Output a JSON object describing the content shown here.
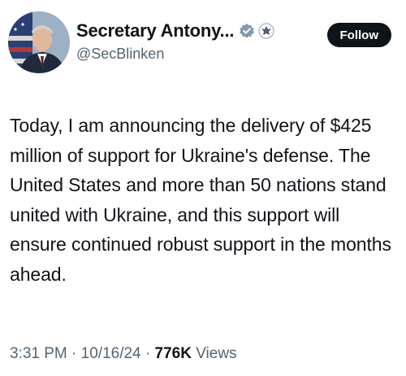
{
  "author": {
    "display_name": "Secretary Antony...",
    "handle": "@SecBlinken",
    "badge_icon": "verified-gray-badge-icon",
    "seal_icon": "state-department-seal-icon",
    "badge_color": "#829aab"
  },
  "follow_button": {
    "label": "Follow"
  },
  "tweet": {
    "text": "Today, I am announcing the delivery of $425 million of support for Ukraine's defense. The United States and more than 50 nations stand united with Ukraine, and this support will ensure continued robust support in the months ahead."
  },
  "meta": {
    "time": "3:31 PM",
    "separator": "·",
    "date": "10/16/24",
    "views_count": "776K",
    "views_label": "Views"
  }
}
